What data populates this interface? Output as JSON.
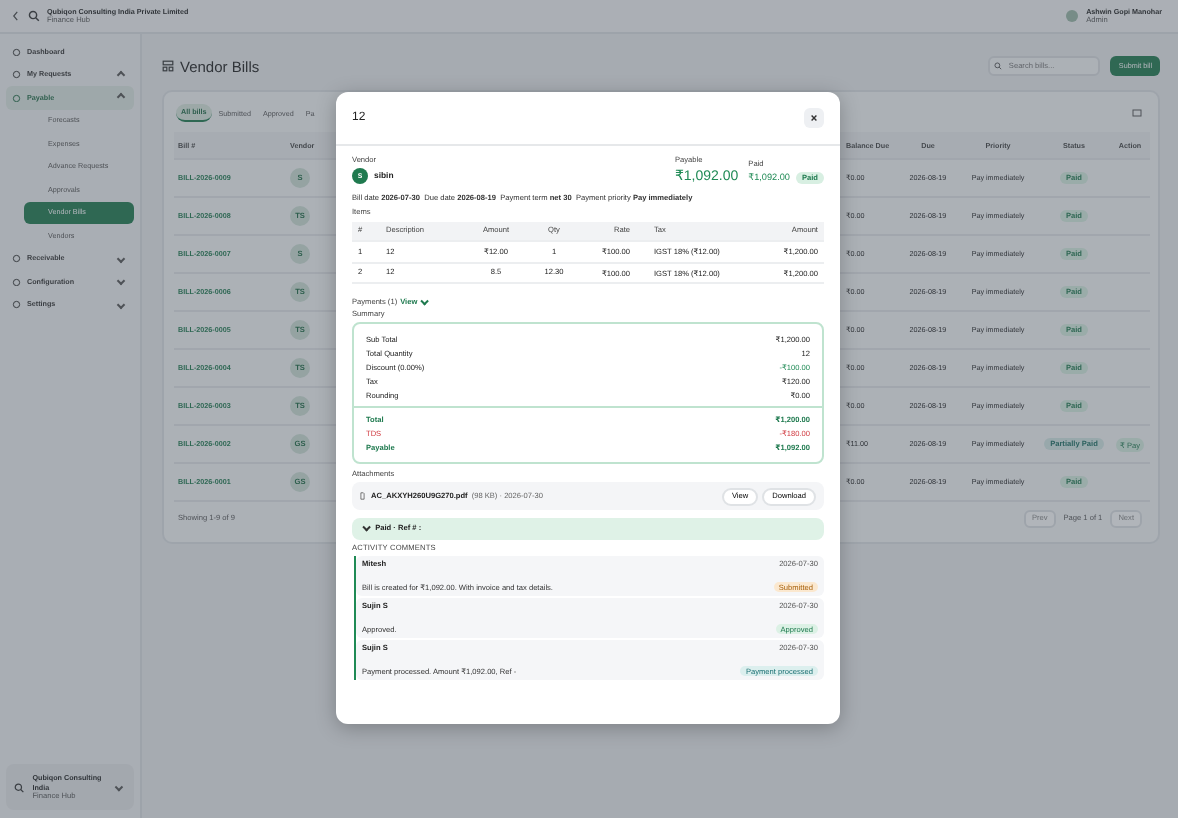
{
  "topbar": {
    "org": "Qubiqon Consulting India Private Limited",
    "org_sub": "Finance Hub",
    "user": "Ashwin Gopi Manohar",
    "role": "Admin"
  },
  "sidebar": {
    "items": [
      {
        "label": "Dashboard",
        "kind": "link",
        "selected": false
      },
      {
        "label": "My Requests",
        "kind": "group",
        "selected": false,
        "expanded": true
      },
      {
        "label": "Payable",
        "kind": "group",
        "selected": true,
        "expanded": true,
        "children": [
          {
            "label": "Forecasts",
            "selected": false
          },
          {
            "label": "Expenses",
            "selected": false
          },
          {
            "label": "Advance Requests",
            "selected": false
          },
          {
            "label": "Approvals",
            "selected": false
          },
          {
            "label": "Vendor Bills",
            "selected": true
          },
          {
            "label": "Vendors",
            "selected": false
          }
        ]
      },
      {
        "label": "Receivable",
        "kind": "group",
        "selected": false,
        "expanded": false
      },
      {
        "label": "Configuration",
        "kind": "group",
        "selected": false,
        "expanded": false
      },
      {
        "label": "Settings",
        "kind": "group",
        "selected": false,
        "expanded": false
      }
    ],
    "footer": {
      "org": "Qubiqon Consulting India",
      "org_sub": "Finance Hub"
    }
  },
  "page": {
    "title": "Vendor Bills",
    "search": {
      "placeholder": "Search bills..."
    },
    "submit_button": "Submit bill",
    "tabs": [
      {
        "label": "All bills",
        "selected": true
      },
      {
        "label": "Submitted",
        "selected": false
      },
      {
        "label": "Approved",
        "selected": false
      },
      {
        "label": "Pa",
        "selected": false
      }
    ],
    "columns": {
      "bill": "Bill #",
      "vendor": "Vendor",
      "balance": "Balance Due",
      "due": "Due",
      "priority": "Priority",
      "status": "Status",
      "action": "Action"
    },
    "rows": [
      {
        "bill": "BILL-2026-0009",
        "initials": "S",
        "balance": "₹0.00",
        "due": "2026-08-19",
        "priority": "Pay immediately",
        "status": "Paid",
        "kind": "paid"
      },
      {
        "bill": "BILL-2026-0008",
        "initials": "TS",
        "balance": "₹0.00",
        "due": "2026-08-19",
        "priority": "Pay immediately",
        "status": "Paid",
        "kind": "paid"
      },
      {
        "bill": "BILL-2026-0007",
        "initials": "S",
        "balance": "₹0.00",
        "due": "2026-08-19",
        "priority": "Pay immediately",
        "status": "Paid",
        "kind": "paid"
      },
      {
        "bill": "BILL-2026-0006",
        "initials": "TS",
        "balance": "₹0.00",
        "due": "2026-08-19",
        "priority": "Pay immediately",
        "status": "Paid",
        "kind": "paid"
      },
      {
        "bill": "BILL-2026-0005",
        "initials": "TS",
        "balance": "₹0.00",
        "due": "2026-08-19",
        "priority": "Pay immediately",
        "status": "Paid",
        "kind": "paid"
      },
      {
        "bill": "BILL-2026-0004",
        "initials": "TS",
        "balance": "₹0.00",
        "due": "2026-08-19",
        "priority": "Pay immediately",
        "status": "Paid",
        "kind": "paid"
      },
      {
        "bill": "BILL-2026-0003",
        "initials": "TS",
        "balance": "₹0.00",
        "due": "2026-08-19",
        "priority": "Pay immediately",
        "status": "Paid",
        "kind": "paid"
      },
      {
        "bill": "BILL-2026-0002",
        "initials": "GS",
        "balance": "₹11.00",
        "due": "2026-08-19",
        "priority": "Pay immediately",
        "status": "Partially Paid",
        "kind": "partial",
        "action": "₹ Pay"
      },
      {
        "bill": "BILL-2026-0001",
        "initials": "GS",
        "balance": "₹0.00",
        "due": "2026-08-19",
        "priority": "Pay immediately",
        "status": "Paid",
        "kind": "paid"
      }
    ],
    "footer": "Showing 1-9 of 9",
    "pagination": {
      "prev": "Prev",
      "page": "Page 1 of 1",
      "next": "Next"
    }
  },
  "modal": {
    "title": "12",
    "vendor": {
      "label": "Vendor",
      "initial": "S",
      "name": "sibin"
    },
    "payable": {
      "label": "Payable",
      "amount": "₹1,092.00"
    },
    "paid": {
      "label": "Paid",
      "amount": "₹1,092.00",
      "badge": "Paid"
    },
    "meta": "Bill date **2026-07-30**  Due date **2026-08-19**  Payment term **net 30**  Payment priority **Pay immediately**",
    "items_label": "Items",
    "item_columns": [
      "#",
      "Description",
      "Amount",
      "Qty",
      "Rate",
      "Tax",
      "Amount"
    ],
    "items": [
      [
        "1",
        "12",
        "₹12.00",
        "1",
        "₹100.00",
        "IGST 18% (₹12.00)",
        "₹1,200.00"
      ],
      [
        "2",
        "12",
        "8.5",
        "12.30",
        "₹100.00",
        "IGST 18% (₹12.00)",
        "₹1,200.00"
      ]
    ],
    "payments": {
      "label": "Payments (1)",
      "link": "View",
      "expanded": false
    },
    "summary_label": "Summary",
    "summary_lines": [
      {
        "label": "Sub Total",
        "value": "₹1,200.00",
        "kind": "plain"
      },
      {
        "label": "Total Quantity",
        "value": "12",
        "kind": "plain"
      },
      {
        "label": "Discount (0.00%)",
        "value": "-₹100.00",
        "kind": "credit"
      },
      {
        "label": "Tax",
        "value": "₹120.00",
        "kind": "plain"
      },
      {
        "label": "Rounding",
        "value": "₹0.00",
        "kind": "plain"
      }
    ],
    "summary_totals": [
      {
        "label": "Total",
        "value": "₹1,200.00",
        "kind": "total"
      },
      {
        "label": "TDS",
        "value": "-₹180.00",
        "kind": "deduction"
      },
      {
        "label": "Payable",
        "value": "₹1,092.00",
        "kind": "total"
      }
    ],
    "attachments_label": "Attachments",
    "attachment": {
      "name": "AC_AKXYH260U9G270.pdf",
      "meta": "(98 KB) · 2026-07-30",
      "view": "View",
      "download": "Download"
    },
    "payment_bar": {
      "text": "Paid · Ref # :",
      "expanded": false
    },
    "activity_label": "ACTIVITY COMMENTS",
    "activity": [
      {
        "author": "Mitesh",
        "date": "2026-07-30",
        "badge": "Submitted",
        "kind": "submitted",
        "text": "Bill is created for ₹1,092.00. With invoice and tax details."
      },
      {
        "author": "Sujin S",
        "date": "2026-07-30",
        "badge": "Approved",
        "kind": "approved",
        "text": "Approved."
      },
      {
        "author": "Sujin S",
        "date": "2026-07-30",
        "badge": "Payment processed",
        "kind": "processed",
        "text": "Payment processed. Amount ₹1,092.00, Ref -"
      }
    ]
  }
}
